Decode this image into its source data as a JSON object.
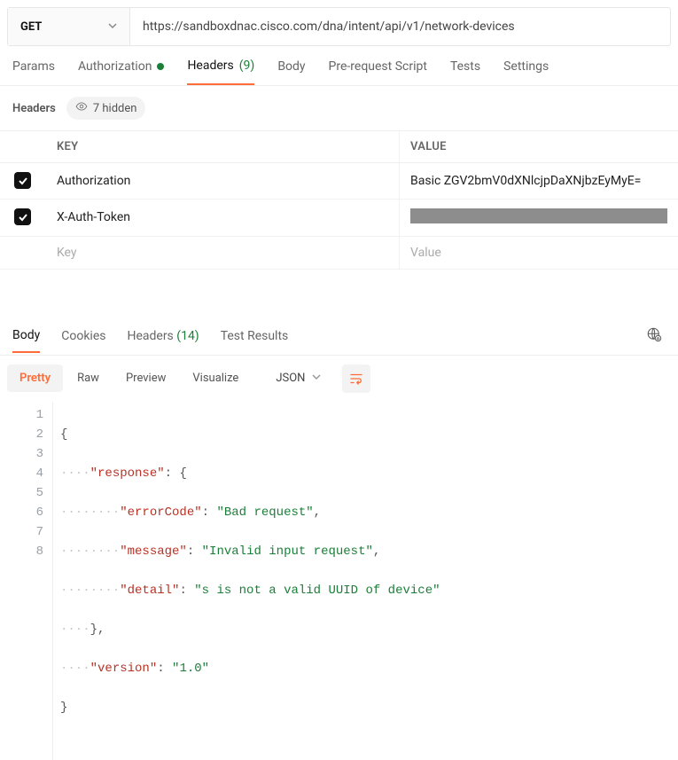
{
  "request": {
    "method": "GET",
    "url": "https://sandboxdnac.cisco.com/dna/intent/api/v1/network-devices"
  },
  "tabs": {
    "params": "Params",
    "authorization": "Authorization",
    "headers": "Headers",
    "headers_count": "(9)",
    "body": "Body",
    "prerequest": "Pre-request Script",
    "tests": "Tests",
    "settings": "Settings"
  },
  "headers_panel": {
    "title": "Headers",
    "hidden_label": "7 hidden",
    "columns": {
      "key": "KEY",
      "value": "VALUE"
    },
    "rows": [
      {
        "checked": true,
        "key": "Authorization",
        "value": "Basic ZGV2bmV0dXNlcjpDaXNjbzEyMyE="
      },
      {
        "checked": true,
        "key": "X-Auth-Token",
        "value_masked": true
      }
    ],
    "placeholder_key": "Key",
    "placeholder_value": "Value"
  },
  "response_tabs": {
    "body": "Body",
    "cookies": "Cookies",
    "headers": "Headers",
    "headers_count": "(14)",
    "test_results": "Test Results"
  },
  "view": {
    "pretty": "Pretty",
    "raw": "Raw",
    "preview": "Preview",
    "visualize": "Visualize",
    "format": "JSON"
  },
  "code": {
    "line_count": 8,
    "l2_key": "\"response\"",
    "l2_brace": "{",
    "l3_key": "\"errorCode\"",
    "l3_val": "\"Bad request\"",
    "l4_key": "\"message\"",
    "l4_val": "\"Invalid input request\"",
    "l5_key": "\"detail\"",
    "l5_val": "\"s is not a valid UUID of device\"",
    "l7_key": "\"version\"",
    "l7_val": "\"1.0\""
  }
}
